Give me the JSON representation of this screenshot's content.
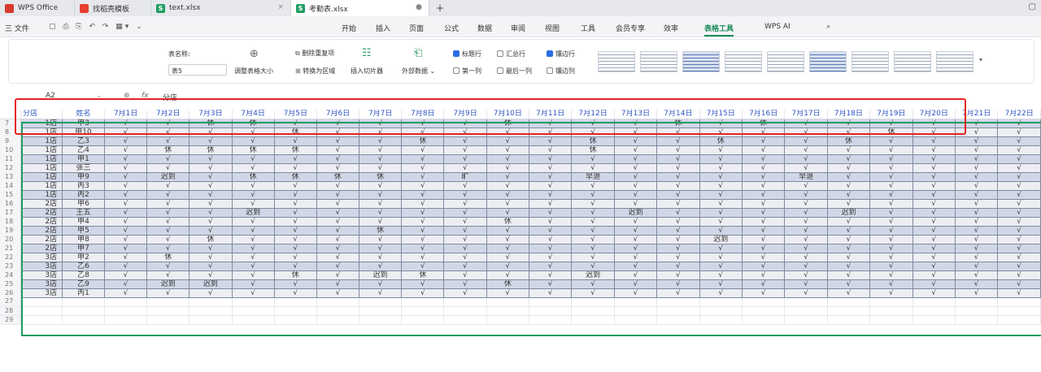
{
  "tabs": [
    {
      "label": "WPS Office",
      "icon": "wps-logo",
      "color": "#d63a2f"
    },
    {
      "label": "找稻壳模板",
      "icon": "docer-logo",
      "color": "#e8402f"
    },
    {
      "label": "text.xlsx",
      "icon": "sheet-s",
      "color": "#1e9e60"
    },
    {
      "label": "考勤表.xlsx",
      "icon": "sheet-s",
      "color": "#1e9e60"
    }
  ],
  "tab_add": "+",
  "menu": {
    "file": "三 文件",
    "items": [
      "开始",
      "插入",
      "页面",
      "公式",
      "数据",
      "审阅",
      "视图",
      "工具",
      "会员专享",
      "效率",
      "表格工具"
    ],
    "ai": "WPS AI",
    "selected": "表格工具"
  },
  "ribbon": {
    "table_name_label": "表名称:",
    "table_name_value": "表5",
    "resize": "调整表格大小",
    "remove_dup": "删除重复项",
    "to_range": "转换为区域",
    "slicer": "插入切片器",
    "external": "外部数据",
    "chk_header": "标题行",
    "chk_total": "汇总行",
    "chk_banded_row": "镶边行",
    "chk_first_col": "第一列",
    "chk_last_col": "最后一列",
    "chk_banded_col": "镶边列",
    "checked": {
      "header": true,
      "total": false,
      "banded_row": true,
      "first_col": false,
      "last_col": false,
      "banded_col": false
    }
  },
  "formula": {
    "cell_ref": "A2",
    "fx": "fx",
    "value": "分店"
  },
  "headers": [
    "分店",
    "姓名",
    "7月1日",
    "7月2日",
    "7月3日",
    "7月4日",
    "7月5日",
    "7月6日",
    "7月7日",
    "7月8日",
    "7月9日",
    "7月10日",
    "7月11日",
    "7月12日",
    "7月13日",
    "7月14日",
    "7月15日",
    "7月16日",
    "7月17日",
    "7月18日",
    "7月19日",
    "7月20日",
    "7月21日",
    "7月22日"
  ],
  "rows": [
    {
      "n": "7",
      "d": [
        "1店",
        "甲3",
        "√",
        "√",
        "休",
        "休",
        "√",
        "√",
        "√",
        "√",
        "√",
        "休",
        "√",
        "√",
        "√",
        "休",
        "√",
        "休",
        "√",
        "√",
        "√",
        "√",
        "√",
        "√"
      ]
    },
    {
      "n": "8",
      "d": [
        "1店",
        "甲10",
        "√",
        "√",
        "√",
        "√",
        "休",
        "√",
        "√",
        "√",
        "√",
        "√",
        "√",
        "√",
        "√",
        "√",
        "√",
        "√",
        "√",
        "√",
        "休",
        "√",
        "√",
        "√"
      ]
    },
    {
      "n": "9",
      "d": [
        "1店",
        "乙3",
        "√",
        "√",
        "√",
        "√",
        "√",
        "√",
        "√",
        "休",
        "√",
        "√",
        "√",
        "休",
        "√",
        "√",
        "休",
        "√",
        "√",
        "休",
        "√",
        "√",
        "√",
        "√"
      ]
    },
    {
      "n": "10",
      "d": [
        "1店",
        "乙4",
        "√",
        "休",
        "休",
        "休",
        "休",
        "√",
        "√",
        "√",
        "√",
        "√",
        "√",
        "休",
        "√",
        "√",
        "√",
        "√",
        "√",
        "√",
        "√",
        "√",
        "√",
        "√"
      ]
    },
    {
      "n": "11",
      "d": [
        "1店",
        "甲1",
        "√",
        "√",
        "√",
        "√",
        "√",
        "√",
        "√",
        "√",
        "√",
        "√",
        "√",
        "√",
        "√",
        "√",
        "√",
        "√",
        "√",
        "√",
        "√",
        "√",
        "√",
        "√"
      ]
    },
    {
      "n": "12",
      "d": [
        "1店",
        "张三",
        "√",
        "√",
        "√",
        "√",
        "√",
        "√",
        "√",
        "√",
        "√",
        "√",
        "√",
        "√",
        "√",
        "√",
        "√",
        "√",
        "√",
        "√",
        "√",
        "√",
        "√",
        "√"
      ]
    },
    {
      "n": "13",
      "d": [
        "1店",
        "甲9",
        "√",
        "迟到",
        "√",
        "休",
        "休",
        "休",
        "休",
        "√",
        "旷",
        "√",
        "√",
        "早退",
        "√",
        "√",
        "√",
        "√",
        "早退",
        "√",
        "√",
        "√",
        "√",
        "√"
      ]
    },
    {
      "n": "14",
      "d": [
        "1店",
        "丙3",
        "√",
        "√",
        "√",
        "√",
        "√",
        "√",
        "√",
        "√",
        "√",
        "√",
        "√",
        "√",
        "√",
        "√",
        "√",
        "√",
        "√",
        "√",
        "√",
        "√",
        "√",
        "√"
      ]
    },
    {
      "n": "15",
      "d": [
        "1店",
        "丙2",
        "√",
        "√",
        "√",
        "√",
        "√",
        "√",
        "√",
        "√",
        "√",
        "√",
        "√",
        "√",
        "√",
        "√",
        "√",
        "√",
        "√",
        "√",
        "√",
        "√",
        "√",
        "√"
      ]
    },
    {
      "n": "16",
      "d": [
        "2店",
        "甲6",
        "√",
        "√",
        "√",
        "√",
        "√",
        "√",
        "√",
        "√",
        "√",
        "√",
        "√",
        "√",
        "√",
        "√",
        "√",
        "√",
        "√",
        "√",
        "√",
        "√",
        "√",
        "√"
      ]
    },
    {
      "n": "17",
      "d": [
        "2店",
        "王五",
        "√",
        "√",
        "√",
        "迟到",
        "√",
        "√",
        "√",
        "√",
        "√",
        "√",
        "√",
        "√",
        "迟到",
        "√",
        "√",
        "√",
        "√",
        "迟到",
        "√",
        "√",
        "√",
        "√"
      ]
    },
    {
      "n": "18",
      "d": [
        "2店",
        "甲4",
        "√",
        "√",
        "√",
        "√",
        "√",
        "√",
        "√",
        "√",
        "√",
        "休",
        "√",
        "√",
        "√",
        "√",
        "√",
        "√",
        "√",
        "√",
        "√",
        "√",
        "√",
        "√"
      ]
    },
    {
      "n": "19",
      "d": [
        "2店",
        "甲5",
        "√",
        "√",
        "√",
        "√",
        "√",
        "√",
        "休",
        "√",
        "√",
        "√",
        "√",
        "√",
        "√",
        "√",
        "√",
        "√",
        "√",
        "√",
        "√",
        "√",
        "√",
        "√"
      ]
    },
    {
      "n": "20",
      "d": [
        "2店",
        "甲8",
        "√",
        "√",
        "休",
        "√",
        "√",
        "√",
        "√",
        "√",
        "√",
        "√",
        "√",
        "√",
        "√",
        "√",
        "迟到",
        "√",
        "√",
        "√",
        "√",
        "√",
        "√",
        "√"
      ]
    },
    {
      "n": "21",
      "d": [
        "2店",
        "甲7",
        "√",
        "√",
        "√",
        "√",
        "√",
        "√",
        "√",
        "√",
        "√",
        "√",
        "√",
        "√",
        "√",
        "√",
        "√",
        "√",
        "√",
        "√",
        "√",
        "√",
        "√",
        "√"
      ]
    },
    {
      "n": "22",
      "d": [
        "3店",
        "甲2",
        "√",
        "休",
        "√",
        "√",
        "√",
        "√",
        "√",
        "√",
        "√",
        "√",
        "√",
        "√",
        "√",
        "√",
        "√",
        "√",
        "√",
        "√",
        "√",
        "√",
        "√",
        "√"
      ]
    },
    {
      "n": "23",
      "d": [
        "3店",
        "乙6",
        "√",
        "√",
        "√",
        "√",
        "√",
        "√",
        "√",
        "√",
        "√",
        "√",
        "√",
        "√",
        "√",
        "√",
        "√",
        "√",
        "√",
        "√",
        "√",
        "√",
        "√",
        "√"
      ]
    },
    {
      "n": "24",
      "d": [
        "3店",
        "乙8",
        "√",
        "√",
        "√",
        "√",
        "休",
        "√",
        "迟到",
        "休",
        "√",
        "√",
        "√",
        "迟到",
        "√",
        "√",
        "√",
        "√",
        "√",
        "√",
        "√",
        "√",
        "√",
        "√"
      ]
    },
    {
      "n": "25",
      "d": [
        "3店",
        "乙9",
        "√",
        "迟到",
        "迟到",
        "√",
        "√",
        "√",
        "√",
        "√",
        "√",
        "休",
        "√",
        "√",
        "√",
        "√",
        "√",
        "√",
        "√",
        "√",
        "√",
        "√",
        "√",
        "√"
      ]
    },
    {
      "n": "26",
      "d": [
        "3店",
        "丙1",
        "√",
        "√",
        "√",
        "√",
        "√",
        "√",
        "√",
        "√",
        "√",
        "√",
        "√",
        "√",
        "√",
        "√",
        "√",
        "√",
        "√",
        "√",
        "√",
        "√",
        "√",
        "√"
      ]
    }
  ],
  "empty_rows": [
    "27",
    "28",
    "29"
  ]
}
